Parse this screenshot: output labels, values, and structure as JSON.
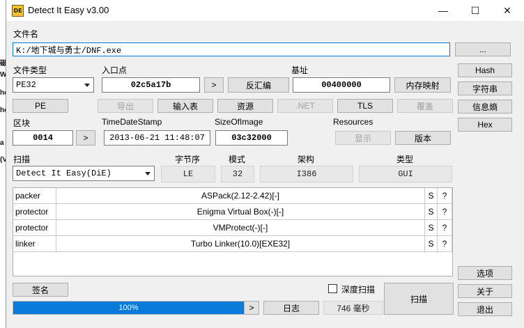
{
  "left_strip": [
    "磁",
    "W",
    "he",
    "he",
    "a",
    "(V"
  ],
  "window": {
    "title": "Detect It Easy v3.00",
    "minimize": "—",
    "maximize": "☐",
    "close": "✕"
  },
  "file": {
    "label": "文件名",
    "path": "K:/地下城与勇士/DNF.exe",
    "browse": "..."
  },
  "filetype": {
    "label": "文件类型",
    "value": "PE32"
  },
  "entry": {
    "label": "入口点",
    "value": "02c5a17b",
    "next": ">",
    "disasm": "反汇编"
  },
  "base": {
    "label": "基址",
    "value": "00400000",
    "memmap": "内存映射"
  },
  "right_buttons": {
    "hash": "Hash",
    "strings": "字符串",
    "entropy": "信息熵",
    "hex": "Hex",
    "options": "选项",
    "about": "关于",
    "exit": "退出"
  },
  "tools": {
    "pe": "PE",
    "export": "导出",
    "import": "输入表",
    "resources": "资源",
    "net": ".NET",
    "tls": "TLS",
    "overlay": "覆盖"
  },
  "section": {
    "label": "区块",
    "value": "0014",
    "next": ">"
  },
  "timestamp": {
    "label": "TimeDateStamp",
    "value": "2013-06-21 11:48:07"
  },
  "sizeofimage": {
    "label": "SizeOfImage",
    "value": "03c32000"
  },
  "resources_group": {
    "label": "Resources",
    "show": "显示",
    "version": "版本"
  },
  "scan": {
    "label": "扫描",
    "engine": "Detect It Easy(DiE)",
    "endian_label": "字节序",
    "endian": "LE",
    "mode_label": "模式",
    "mode": "32",
    "arch_label": "架构",
    "arch": "I386",
    "type_label": "类型",
    "type": "GUI"
  },
  "results": [
    {
      "kind": "packer",
      "name": "ASPack(2.12-2.42)[-]",
      "s": "S",
      "q": "?"
    },
    {
      "kind": "protector",
      "name": "Enigma Virtual Box(-)[-]",
      "s": "S",
      "q": "?"
    },
    {
      "kind": "protector",
      "name": "VMProtect(-)[-]",
      "s": "S",
      "q": "?"
    },
    {
      "kind": "linker",
      "name": "Turbo Linker(10.0)[EXE32]",
      "s": "S",
      "q": "?"
    }
  ],
  "bottom": {
    "signature": "签名",
    "deep_scan": "深度扫描",
    "progress_text": "100%",
    "progress_value": 100,
    "next": ">",
    "log": "日志",
    "elapsed": "746 毫秒",
    "scan_button": "扫描"
  }
}
